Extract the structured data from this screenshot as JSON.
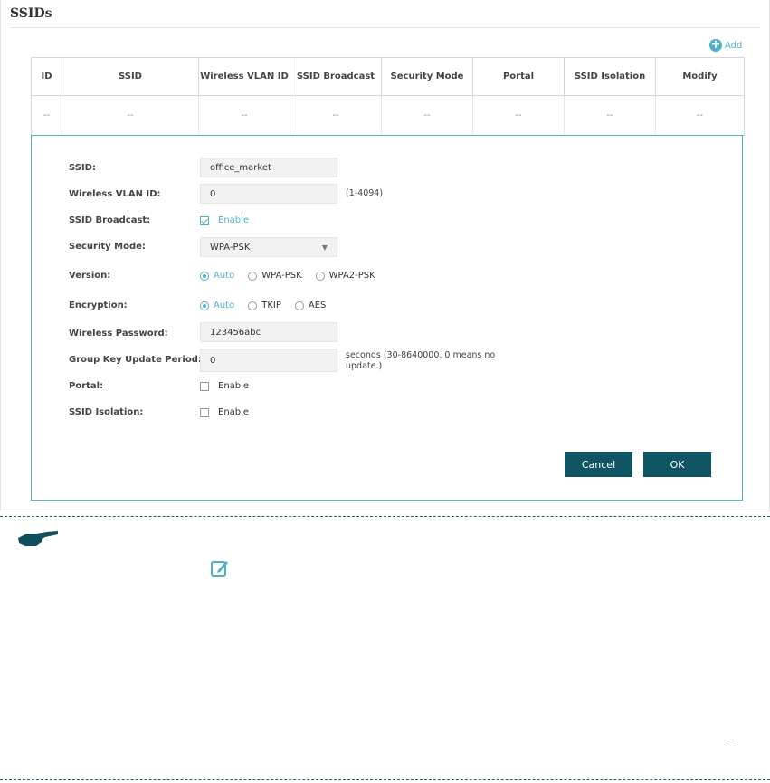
{
  "panel": {
    "title": "SSIDs"
  },
  "toolbar": {
    "add_label": "Add",
    "add_icon": "plus-circle-icon"
  },
  "table": {
    "headers": [
      "ID",
      "SSID",
      "Wireless VLAN ID",
      "SSID Broadcast",
      "Security Mode",
      "Portal",
      "SSID Isolation",
      "Modify"
    ],
    "row": [
      "--",
      "--",
      "--",
      "--",
      "--",
      "--",
      "--",
      "--"
    ]
  },
  "form": {
    "ssid": {
      "label": "SSID:",
      "value": "office_market"
    },
    "vlan": {
      "label": "Wireless VLAN ID:",
      "value": "0",
      "hint": "(1-4094)"
    },
    "broadcast": {
      "label": "SSID Broadcast:",
      "option": "Enable",
      "checked": true
    },
    "security": {
      "label": "Security Mode:",
      "value": "WPA-PSK"
    },
    "version": {
      "label": "Version:",
      "options": [
        "Auto",
        "WPA-PSK",
        "WPA2-PSK"
      ],
      "selected": "Auto"
    },
    "encryption": {
      "label": "Encryption:",
      "options": [
        "Auto",
        "TKIP",
        "AES"
      ],
      "selected": "Auto"
    },
    "password": {
      "label": "Wireless Password:",
      "value": "123456abc"
    },
    "group_key": {
      "label": "Group Key Update Period:",
      "value": "0",
      "hint_line1": "seconds (30-8640000. 0 means no",
      "hint_line2": "update.)"
    },
    "portal": {
      "label": "Portal:",
      "option": "Enable",
      "checked": false
    },
    "isolation": {
      "label": "SSID Isolation:",
      "option": "Enable",
      "checked": false
    },
    "cancel_label": "Cancel",
    "ok_label": "OK"
  },
  "colors": {
    "accent": "#4fb2c4",
    "button": "#0f5563",
    "dash": "#1f5f72"
  },
  "icons": {
    "note": "pointing-hand-icon",
    "edit": "edit-icon"
  }
}
